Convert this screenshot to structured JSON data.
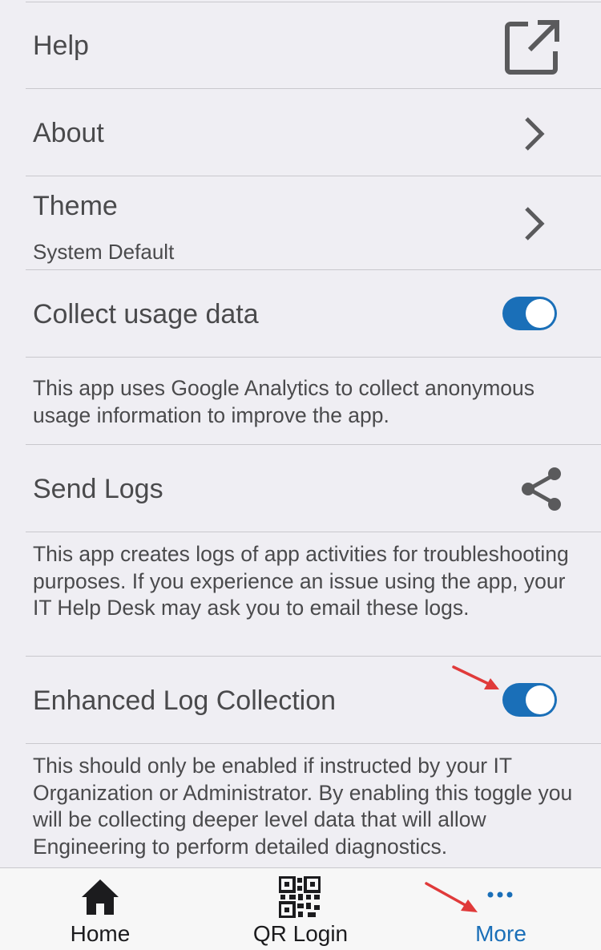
{
  "settings": {
    "help": {
      "label": "Help",
      "icon": "open-external-icon"
    },
    "about": {
      "label": "About",
      "icon": "chevron-right-icon"
    },
    "theme": {
      "label": "Theme",
      "value": "System Default",
      "icon": "chevron-right-icon"
    },
    "collect_usage": {
      "label": "Collect usage data",
      "enabled": true
    },
    "collect_usage_desc": "This app uses Google Analytics to collect anonymous usage information to improve the app.",
    "send_logs": {
      "label": "Send Logs",
      "icon": "share-icon"
    },
    "send_logs_desc": "This app creates logs of app activities for troubleshooting purposes. If you experience an issue using the app, your IT Help Desk may ask you to email these logs.",
    "enhanced_log": {
      "label": "Enhanced Log Collection",
      "enabled": true
    },
    "enhanced_log_desc": "This should only be enabled if instructed by your IT Organization or Administrator. By enabling this toggle you will be collecting deeper level data that will allow Engineering to perform detailed diagnostics."
  },
  "tabbar": {
    "tabs": [
      {
        "label": "Home",
        "icon": "home-icon",
        "active": false
      },
      {
        "label": "QR Login",
        "icon": "qr-code-icon",
        "active": false
      },
      {
        "label": "More",
        "icon": "more-dots-icon",
        "active": true
      }
    ]
  },
  "colors": {
    "accent": "#1a6fb8",
    "background": "#efeef3",
    "annotation_arrow": "#e03a3a"
  }
}
